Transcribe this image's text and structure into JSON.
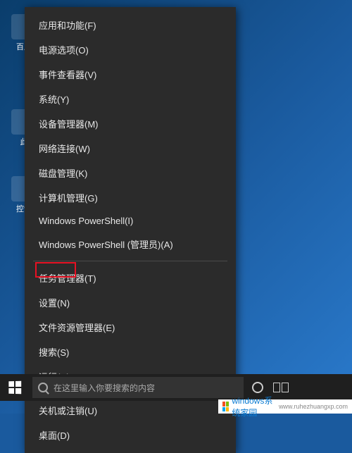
{
  "desktop_icons": {
    "icon1_label": "百度",
    "icon2_label": "此",
    "icon3_label": "控制"
  },
  "context_menu": {
    "items": [
      {
        "label": "应用和功能(F)",
        "name": "apps-and-features"
      },
      {
        "label": "电源选项(O)",
        "name": "power-options"
      },
      {
        "label": "事件查看器(V)",
        "name": "event-viewer"
      },
      {
        "label": "系统(Y)",
        "name": "system"
      },
      {
        "label": "设备管理器(M)",
        "name": "device-manager"
      },
      {
        "label": "网络连接(W)",
        "name": "network-connections"
      },
      {
        "label": "磁盘管理(K)",
        "name": "disk-management"
      },
      {
        "label": "计算机管理(G)",
        "name": "computer-management"
      },
      {
        "label": "Windows PowerShell(I)",
        "name": "powershell"
      },
      {
        "label": "Windows PowerShell (管理员)(A)",
        "name": "powershell-admin"
      }
    ],
    "items2": [
      {
        "label": "任务管理器(T)",
        "name": "task-manager"
      },
      {
        "label": "设置(N)",
        "name": "settings",
        "highlighted": true
      },
      {
        "label": "文件资源管理器(E)",
        "name": "file-explorer"
      },
      {
        "label": "搜索(S)",
        "name": "search"
      },
      {
        "label": "运行(R)",
        "name": "run"
      }
    ],
    "items3": [
      {
        "label": "关机或注销(U)",
        "name": "shutdown-signout",
        "arrow": true
      },
      {
        "label": "桌面(D)",
        "name": "desktop"
      }
    ]
  },
  "taskbar": {
    "search_placeholder": "在这里输入你要搜索的内容"
  },
  "watermark": {
    "brand": "windows系统家园",
    "url": "www.ruhezhuangxp.com"
  },
  "colors": {
    "menu_bg": "#2b2b2b",
    "highlight": "#e81123",
    "desktop": "#1a5a9e"
  }
}
